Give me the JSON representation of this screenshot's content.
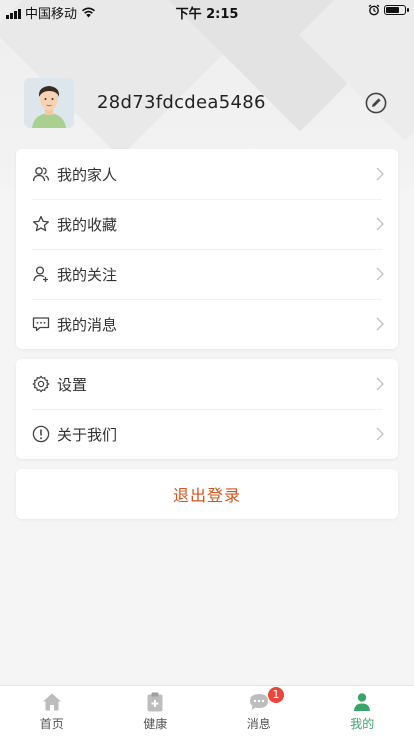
{
  "status_bar": {
    "carrier": "中国移动",
    "time": "下午 2:15",
    "battery_level": 0.8
  },
  "profile": {
    "username": "28d73fdcdea5486",
    "avatar_icon": "person-avatar-icon",
    "edit_icon": "pencil-edit-icon"
  },
  "menu_group_1": [
    {
      "label": "我的家人",
      "icon": "family-icon"
    },
    {
      "label": "我的收藏",
      "icon": "star-icon"
    },
    {
      "label": "我的关注",
      "icon": "follow-user-icon"
    },
    {
      "label": "我的消息",
      "icon": "message-icon"
    }
  ],
  "menu_group_2": [
    {
      "label": "设置",
      "icon": "gear-icon"
    },
    {
      "label": "关于我们",
      "icon": "info-icon"
    }
  ],
  "logout_label": "退出登录",
  "tabbar": {
    "tabs": [
      {
        "label": "首页",
        "icon": "home-icon"
      },
      {
        "label": "健康",
        "icon": "clipboard-health-icon"
      },
      {
        "label": "消息",
        "icon": "chat-bubble-icon",
        "badge": "1"
      },
      {
        "label": "我的",
        "icon": "profile-icon",
        "active": true
      }
    ]
  },
  "colors": {
    "accent_green": "#3aa56b",
    "logout_orange": "#d2551d",
    "badge_red": "#e8473b"
  }
}
